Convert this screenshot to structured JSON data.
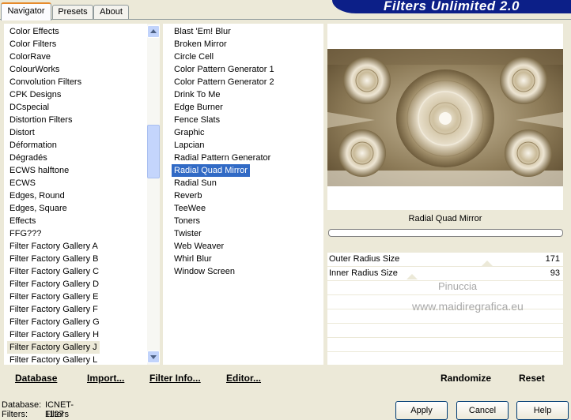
{
  "tabs": [
    "Navigator",
    "Presets",
    "About"
  ],
  "app_title": "Filters Unlimited 2.0",
  "categories": [
    "Color Effects",
    "Color Filters",
    "ColorRave",
    "ColourWorks",
    "Convolution Filters",
    "CPK Designs",
    "DCspecial",
    "Distortion Filters",
    "Distort",
    "Déformation",
    "Dégradés",
    "ECWS halftone",
    "ECWS",
    "Edges, Round",
    "Edges, Square",
    "Effects",
    "FFG???",
    "Filter Factory Gallery A",
    "Filter Factory Gallery B",
    "Filter Factory Gallery C",
    "Filter Factory Gallery D",
    "Filter Factory Gallery E",
    "Filter Factory Gallery F",
    "Filter Factory Gallery G",
    "Filter Factory Gallery H",
    "Filter Factory Gallery J",
    "Filter Factory Gallery L"
  ],
  "filters": [
    "Blast 'Em! Blur",
    "Broken Mirror",
    "Circle Cell",
    "Color Pattern Generator 1",
    "Color Pattern Generator 2",
    "Drink To Me",
    "Edge Burner",
    "Fence Slats",
    "Graphic",
    "Lapcian",
    "Radial Pattern Generator",
    "Radial Quad Mirror",
    "Radial Sun",
    "Reverb",
    "TeeWee",
    "Toners",
    "Twister",
    "Web Weaver",
    "Whirl Blur",
    "Window Screen"
  ],
  "selected_filter": "Radial Quad Mirror",
  "current_category": "Filter Factory Gallery J",
  "filter_label": "Radial Quad Mirror",
  "params": [
    {
      "name": "Outer Radius Size",
      "value": "171"
    },
    {
      "name": "Inner Radius Size",
      "value": "93"
    }
  ],
  "watermark": {
    "line1": "Pinuccia",
    "line2": "www.maidiregrafica.eu"
  },
  "left_buttons": [
    "Database",
    "Import...",
    "Filter Info...",
    "Editor..."
  ],
  "right_buttons": [
    "Randomize",
    "Reset"
  ],
  "dialog_buttons": {
    "apply": "Apply",
    "cancel": "Cancel",
    "help": "Help"
  },
  "status": {
    "db_label": "Database:",
    "db_value": "ICNET-Filters",
    "filters_label": "Filters:",
    "filters_value": "1127"
  },
  "colors": {
    "selection": "#316ac5",
    "banner": "#0c1f88",
    "preview_tone": "#9c8a66"
  }
}
